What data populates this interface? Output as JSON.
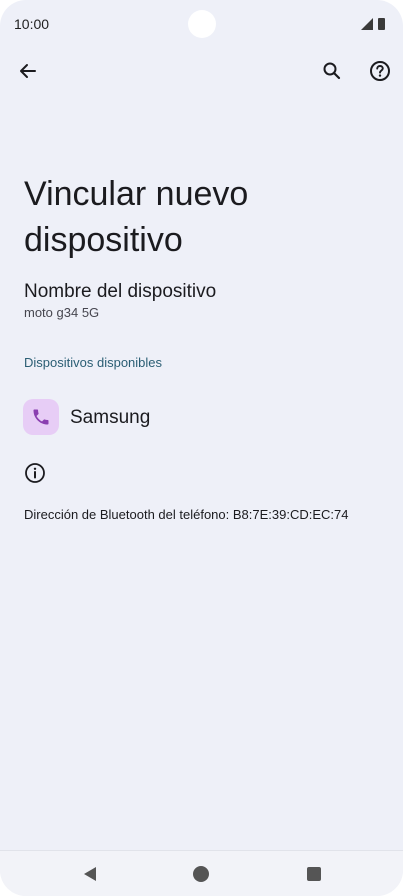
{
  "status_bar": {
    "time": "10:00",
    "icons": [
      "signal-icon",
      "battery-icon"
    ]
  },
  "app_bar": {
    "icons": [
      "back-arrow-icon",
      "search-icon",
      "help-icon"
    ]
  },
  "page": {
    "title": "Vincular nuevo dispositivo"
  },
  "device_name": {
    "label": "Nombre del dispositivo",
    "value": "moto g34 5G"
  },
  "available_devices": {
    "header": "Dispositivos disponibles",
    "items": [
      {
        "icon": "phone-icon",
        "label": "Samsung"
      }
    ]
  },
  "footer_info": {
    "icon": "info-icon",
    "bt_address": "Dirección de Bluetooth del teléfono: B8:7E:39:CD:EC:74"
  },
  "nav_bar": {
    "icons": [
      "nav-back-icon",
      "nav-home-icon",
      "nav-recents-icon"
    ]
  },
  "colors": {
    "background": "#eef0f8",
    "section_header": "#2b5e74",
    "device_icon_bg": "#e7cdf6",
    "device_icon_fg": "#8a3fb0"
  }
}
